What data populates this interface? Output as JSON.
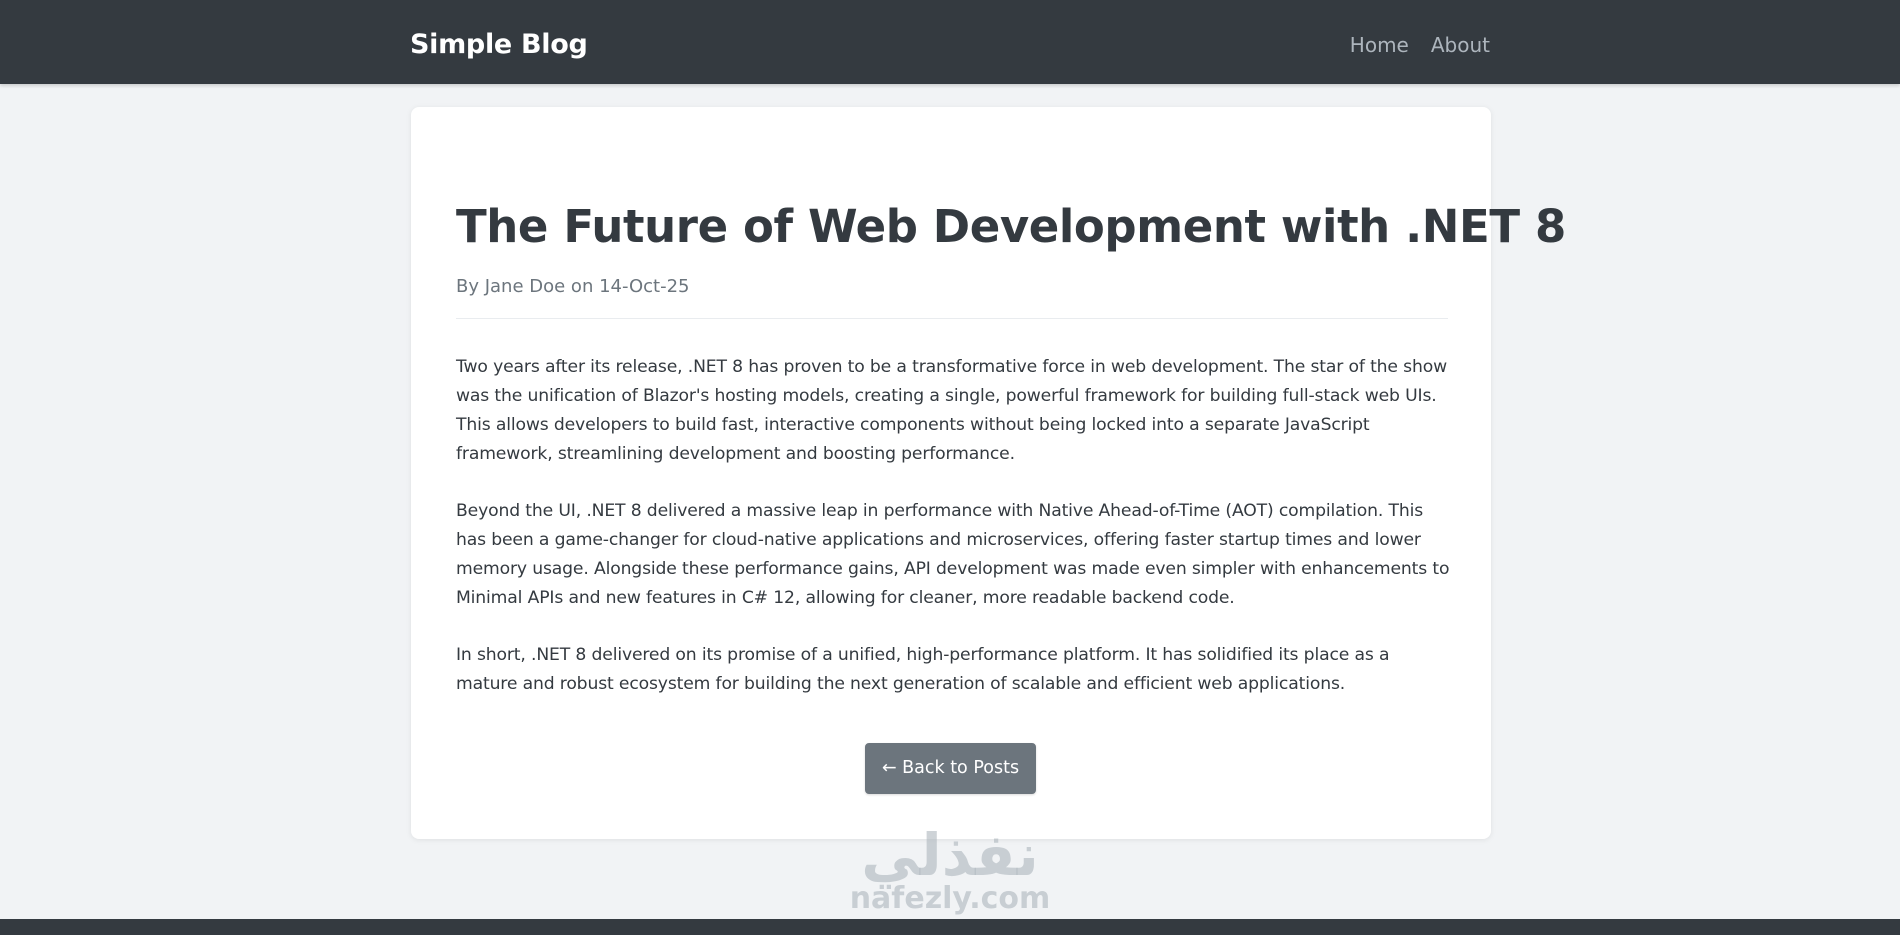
{
  "navbar": {
    "brand": "Simple Blog",
    "links": [
      "Home",
      "About"
    ]
  },
  "post": {
    "title": "The Future of Web Development with .NET 8",
    "meta": "By Jane Doe on 14-Oct-25",
    "paragraphs": [
      "Two years after its release, .NET 8 has proven to be a transformative force in web development. The star of the show was the unification of Blazor's hosting models, creating a single, powerful framework for building full-stack web UIs. This allows developers to build fast, interactive components without being locked into a separate JavaScript framework, streamlining development and boosting performance.",
      "Beyond the UI, .NET 8 delivered a massive leap in performance with Native Ahead-of-Time (AOT) compilation. This has been a game-changer for cloud-native applications and microservices, offering faster startup times and lower memory usage. Alongside these performance gains, API development was made even simpler with enhancements to Minimal APIs and new features in C# 12, allowing for cleaner, more readable backend code.",
      "In short, .NET 8 delivered on its promise of a unified, high-performance platform. It has solidified its place as a mature and robust ecosystem for building the next generation of scalable and efficient web applications."
    ],
    "back_button": "← Back to Posts"
  },
  "watermark": {
    "arabic": "نفذلي",
    "latin": "nafezly.com"
  },
  "colors": {
    "navbar_bg": "#343a40",
    "page_bg": "#f1f3f5",
    "button_bg": "#6c757d",
    "text": "#343a40",
    "muted": "#6c757d"
  }
}
